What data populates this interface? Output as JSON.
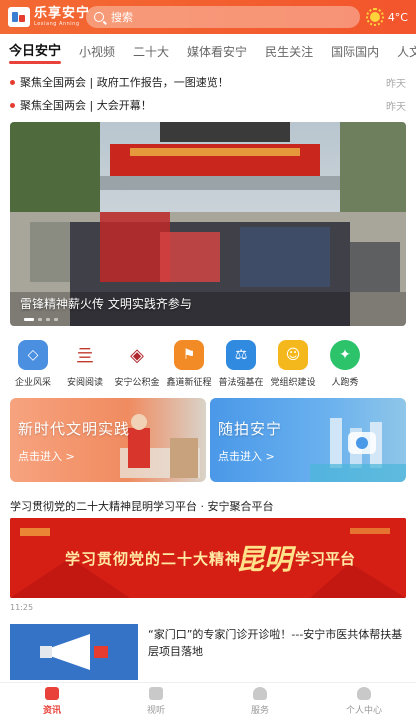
{
  "header": {
    "logo_title": "乐享安宁",
    "logo_sub": "Lexiang Anning",
    "search_placeholder": "搜索",
    "weather_temp": "4°C"
  },
  "tabs": [
    {
      "label": "今日安宁",
      "active": true
    },
    {
      "label": "小视频"
    },
    {
      "label": "二十大"
    },
    {
      "label": "媒体看安宁"
    },
    {
      "label": "民生关注"
    },
    {
      "label": "国际国内"
    },
    {
      "label": "人文安"
    }
  ],
  "headlines": [
    {
      "text": "聚焦全国两会 | 政府工作报告，一图速览！",
      "time": "昨天"
    },
    {
      "text": "聚焦全国两会 | 大会开幕！",
      "time": "昨天"
    }
  ],
  "banner": {
    "caption": "雷锋精神薪火传  文明实践齐参与"
  },
  "shortcuts": [
    {
      "label": "企业风采",
      "icon": "enterprise-icon",
      "color": "#4a8fe0"
    },
    {
      "label": "安阅阅读",
      "icon": "reading-icon",
      "color": "#c0392b"
    },
    {
      "label": "安宁公积金",
      "icon": "fund-icon",
      "color": "#b0272d"
    },
    {
      "label": "鑫道新征程",
      "icon": "flag-icon",
      "color": "#f28a26"
    },
    {
      "label": "普法强基在",
      "icon": "scales-icon",
      "color": "#2f8ae0"
    },
    {
      "label": "党组织建设",
      "icon": "party-icon",
      "color": "#f5b81c"
    },
    {
      "label": "人跑秀",
      "icon": "runner-icon",
      "color": "#2cc36b"
    }
  ],
  "cards": [
    {
      "title": "新时代文明实践",
      "link": "点击进入 >",
      "color": "#f08b60"
    },
    {
      "title": "随拍安宁",
      "link": "点击进入 >",
      "color": "#4a98e8"
    }
  ],
  "section_title": "学习贯彻党的二十大精神昆明学习平台 · 安宁聚合平台",
  "promo": {
    "text_left": "学习贯彻党的二十大精神",
    "text_kunming": "昆明",
    "text_right": "学习平台"
  },
  "timestamp": "11:25",
  "article": {
    "title": "“家门口”的专家门诊开诊啦！---安宁市医共体帮扶基层项目落地"
  },
  "tabbar": [
    {
      "label": "资讯",
      "icon": "news-icon",
      "active": true
    },
    {
      "label": "视听",
      "icon": "video-icon"
    },
    {
      "label": "服务",
      "icon": "service-icon"
    },
    {
      "label": "个人中心",
      "icon": "user-icon"
    }
  ]
}
